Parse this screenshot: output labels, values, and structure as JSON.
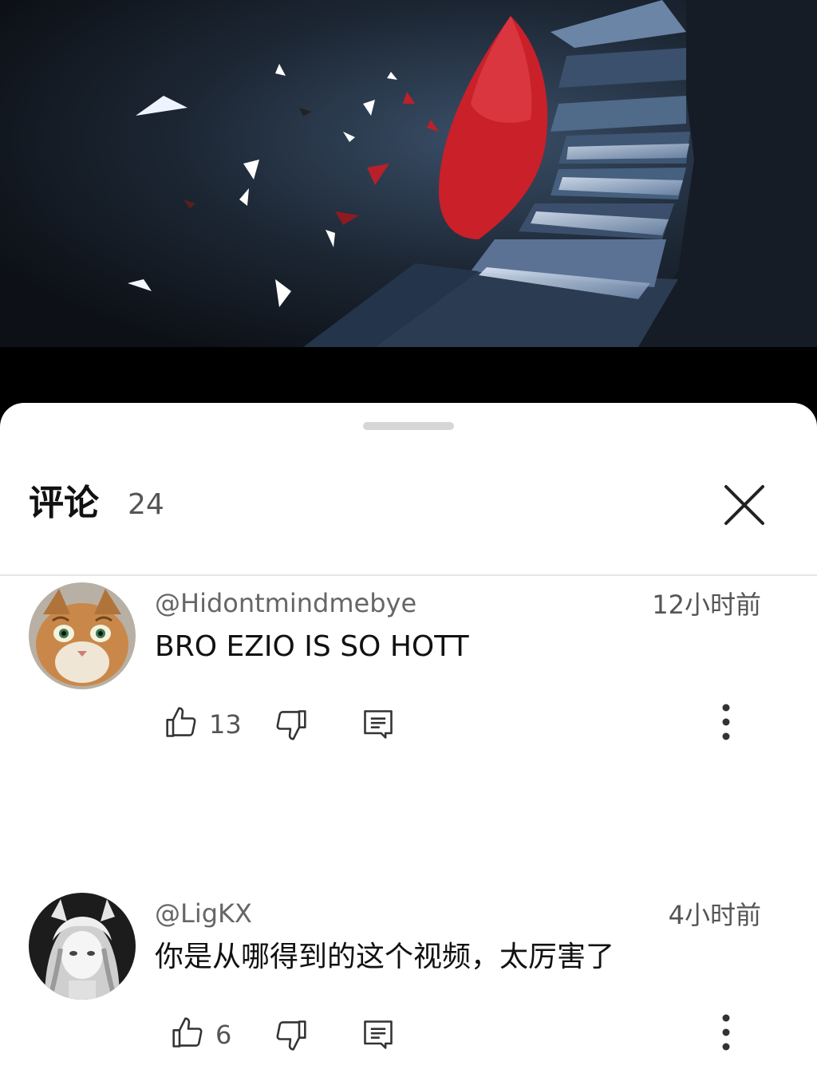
{
  "header": {
    "title": "评论",
    "count": "24"
  },
  "icons": {
    "close": "close-icon",
    "like": "thumbs-up-icon",
    "dislike": "thumbs-down-icon",
    "reply": "reply-icon",
    "more": "more-vertical-icon"
  },
  "colors": {
    "sheet_bg": "#ffffff",
    "title": "#111111",
    "secondary_text": "#666666",
    "icon": "#333333",
    "video_accent": "#d0262e"
  },
  "comments": [
    {
      "author": "@Hidontmindmebye",
      "time": "12小时前",
      "text": "BRO EZIO IS SO HOTT",
      "likes": "13"
    },
    {
      "author": "@LigKX",
      "time": "4小时前",
      "text": "你是从哪得到的这个视频，太厉害了",
      "likes": "6"
    }
  ]
}
